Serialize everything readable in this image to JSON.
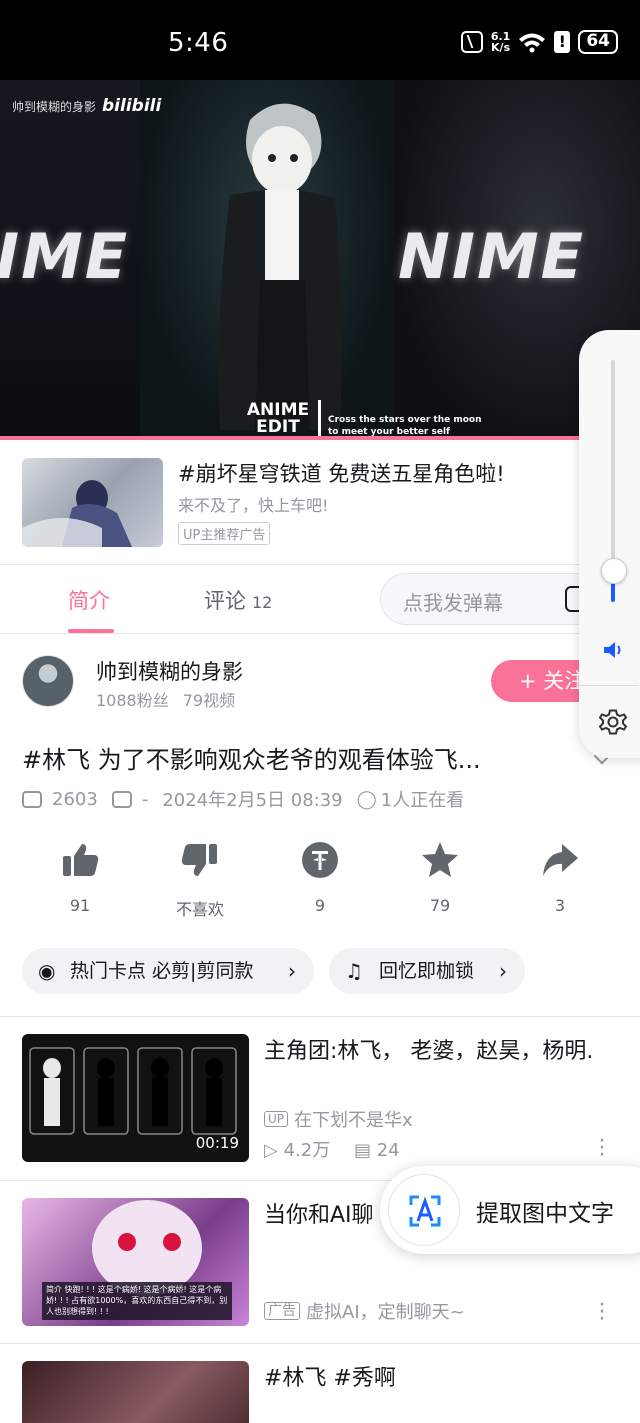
{
  "status_bar": {
    "time": "5:46",
    "net_speed_value": "6.1",
    "net_speed_unit": "K/s",
    "battery": "64"
  },
  "video": {
    "watermark_user": "帅到模糊的身影",
    "watermark_brand": "bilibili",
    "overlay_left": "IME",
    "overlay_right": "NIME",
    "caption_title": "ANIME EDIT",
    "caption_sub": "Cross the stars over the moon to meet your better self",
    "progress": 1.0
  },
  "ad": {
    "title": "#崩坏星穹铁道 免费送五星角色啦!",
    "subtitle": "来不及了，快上车吧!",
    "tag": "UP主推荐广告"
  },
  "tabs": {
    "intro": "简介",
    "comments": "评论",
    "comments_count": "12",
    "danmaku_placeholder": "点我发弹幕"
  },
  "uploader": {
    "name": "帅到模糊的身影",
    "fans": "1088粉丝",
    "videos": "79视频",
    "follow_label": "+ 关注"
  },
  "video_info": {
    "title": "#林飞 为了不影响观众老爷的观看体验飞...",
    "plays": "2603",
    "danmaku": "-",
    "date": "2024年2月5日 08:39",
    "watching": "1人正在看"
  },
  "actions": [
    {
      "icon": "thumbs-up-icon",
      "label": "91"
    },
    {
      "icon": "thumbs-down-icon",
      "label": "不喜欢"
    },
    {
      "icon": "coin-icon",
      "label": "9"
    },
    {
      "icon": "star-icon",
      "label": "79"
    },
    {
      "icon": "share-icon",
      "label": "3"
    }
  ],
  "chips": {
    "hot": "热门卡点   必剪|剪同款",
    "music": "回忆即枷锁"
  },
  "recommended": [
    {
      "title": "主角团:林飞， 老婆，赵昊，杨明.",
      "up_badge": "UP",
      "up": "在下划不是华x",
      "plays": "4.2万",
      "danmaku": "24",
      "duration": "00:19"
    },
    {
      "title": "当你和AI聊",
      "up_badge": "广告",
      "up": "虚拟AI，定制聊天~",
      "thumb_text": "简介 快跑! ! ! 这是个病娇! 这是个病娇! 这是个病娇! ! ! 占有欲1000%，喜欢的东西自己得不到，别人也别想得到! ! !"
    },
    {
      "title": "#林飞 #秀啊"
    }
  ],
  "volume": {
    "level": 0.12
  },
  "extract_popup": {
    "label": "提取图中文字"
  },
  "colors": {
    "accent": "#fb7299",
    "volume_blue": "#1a5cff"
  }
}
